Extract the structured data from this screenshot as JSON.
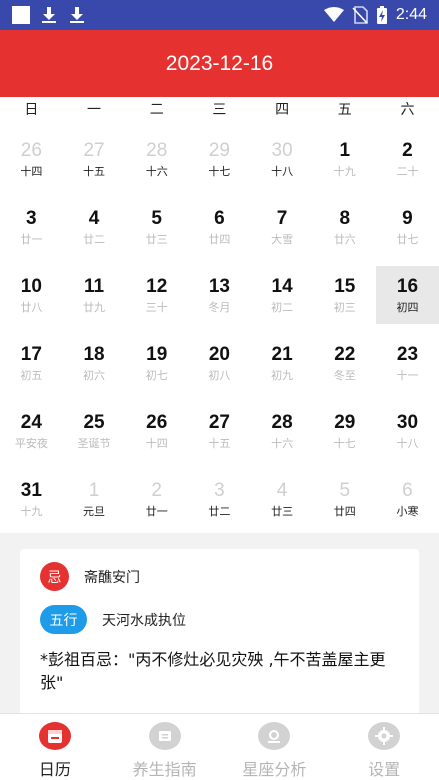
{
  "status_bar": {
    "time": "2:44"
  },
  "header": {
    "title": "2023-12-16"
  },
  "weekdays": [
    "日",
    "一",
    "二",
    "三",
    "四",
    "五",
    "六"
  ],
  "weeks": [
    [
      {
        "day": "26",
        "lunar": "十四",
        "other": true,
        "dark": true
      },
      {
        "day": "27",
        "lunar": "十五",
        "other": true,
        "dark": true
      },
      {
        "day": "28",
        "lunar": "十六",
        "other": true,
        "dark": true
      },
      {
        "day": "29",
        "lunar": "十七",
        "other": true,
        "dark": true
      },
      {
        "day": "30",
        "lunar": "十八",
        "other": true,
        "dark": true
      },
      {
        "day": "1",
        "lunar": "十九"
      },
      {
        "day": "2",
        "lunar": "二十"
      }
    ],
    [
      {
        "day": "3",
        "lunar": "廿一"
      },
      {
        "day": "4",
        "lunar": "廿二"
      },
      {
        "day": "5",
        "lunar": "廿三"
      },
      {
        "day": "6",
        "lunar": "廿四"
      },
      {
        "day": "7",
        "lunar": "大雪"
      },
      {
        "day": "8",
        "lunar": "廿六"
      },
      {
        "day": "9",
        "lunar": "廿七"
      }
    ],
    [
      {
        "day": "10",
        "lunar": "廿八"
      },
      {
        "day": "11",
        "lunar": "廿九"
      },
      {
        "day": "12",
        "lunar": "三十"
      },
      {
        "day": "13",
        "lunar": "冬月"
      },
      {
        "day": "14",
        "lunar": "初二"
      },
      {
        "day": "15",
        "lunar": "初三"
      },
      {
        "day": "16",
        "lunar": "初四",
        "selected": true,
        "dark": true
      }
    ],
    [
      {
        "day": "17",
        "lunar": "初五"
      },
      {
        "day": "18",
        "lunar": "初六"
      },
      {
        "day": "19",
        "lunar": "初七"
      },
      {
        "day": "20",
        "lunar": "初八"
      },
      {
        "day": "21",
        "lunar": "初九"
      },
      {
        "day": "22",
        "lunar": "冬至"
      },
      {
        "day": "23",
        "lunar": "十一"
      }
    ],
    [
      {
        "day": "24",
        "lunar": "平安夜"
      },
      {
        "day": "25",
        "lunar": "圣诞节"
      },
      {
        "day": "26",
        "lunar": "十四"
      },
      {
        "day": "27",
        "lunar": "十五"
      },
      {
        "day": "28",
        "lunar": "十六"
      },
      {
        "day": "29",
        "lunar": "十七"
      },
      {
        "day": "30",
        "lunar": "十八"
      }
    ],
    [
      {
        "day": "31",
        "lunar": "十九"
      },
      {
        "day": "1",
        "lunar": "元旦",
        "other": true,
        "dark": true
      },
      {
        "day": "2",
        "lunar": "廿一",
        "other": true,
        "dark": true
      },
      {
        "day": "3",
        "lunar": "廿二",
        "other": true,
        "dark": true
      },
      {
        "day": "4",
        "lunar": "廿三",
        "other": true,
        "dark": true
      },
      {
        "day": "5",
        "lunar": "廿四",
        "other": true,
        "dark": true
      },
      {
        "day": "6",
        "lunar": "小寒",
        "other": true,
        "dark": true
      }
    ]
  ],
  "info": {
    "ji_badge": "忌",
    "ji_text": "斋醮安门",
    "wuxing_badge": "五行",
    "wuxing_text": "天河水成执位",
    "pengzu": "*彭祖百忌：\"丙不修灶必见灾殃 ,午不苦盖屋主更张\""
  },
  "nav": [
    {
      "label": "日历",
      "icon": "calendar-icon",
      "active": true
    },
    {
      "label": "养生指南",
      "icon": "health-guide-icon"
    },
    {
      "label": "星座分析",
      "icon": "zodiac-icon"
    },
    {
      "label": "设置",
      "icon": "gear-icon"
    }
  ],
  "colors": {
    "accent": "#e5312f",
    "status_bar": "#3949ab",
    "wuxing_badge": "#1e9be9"
  }
}
